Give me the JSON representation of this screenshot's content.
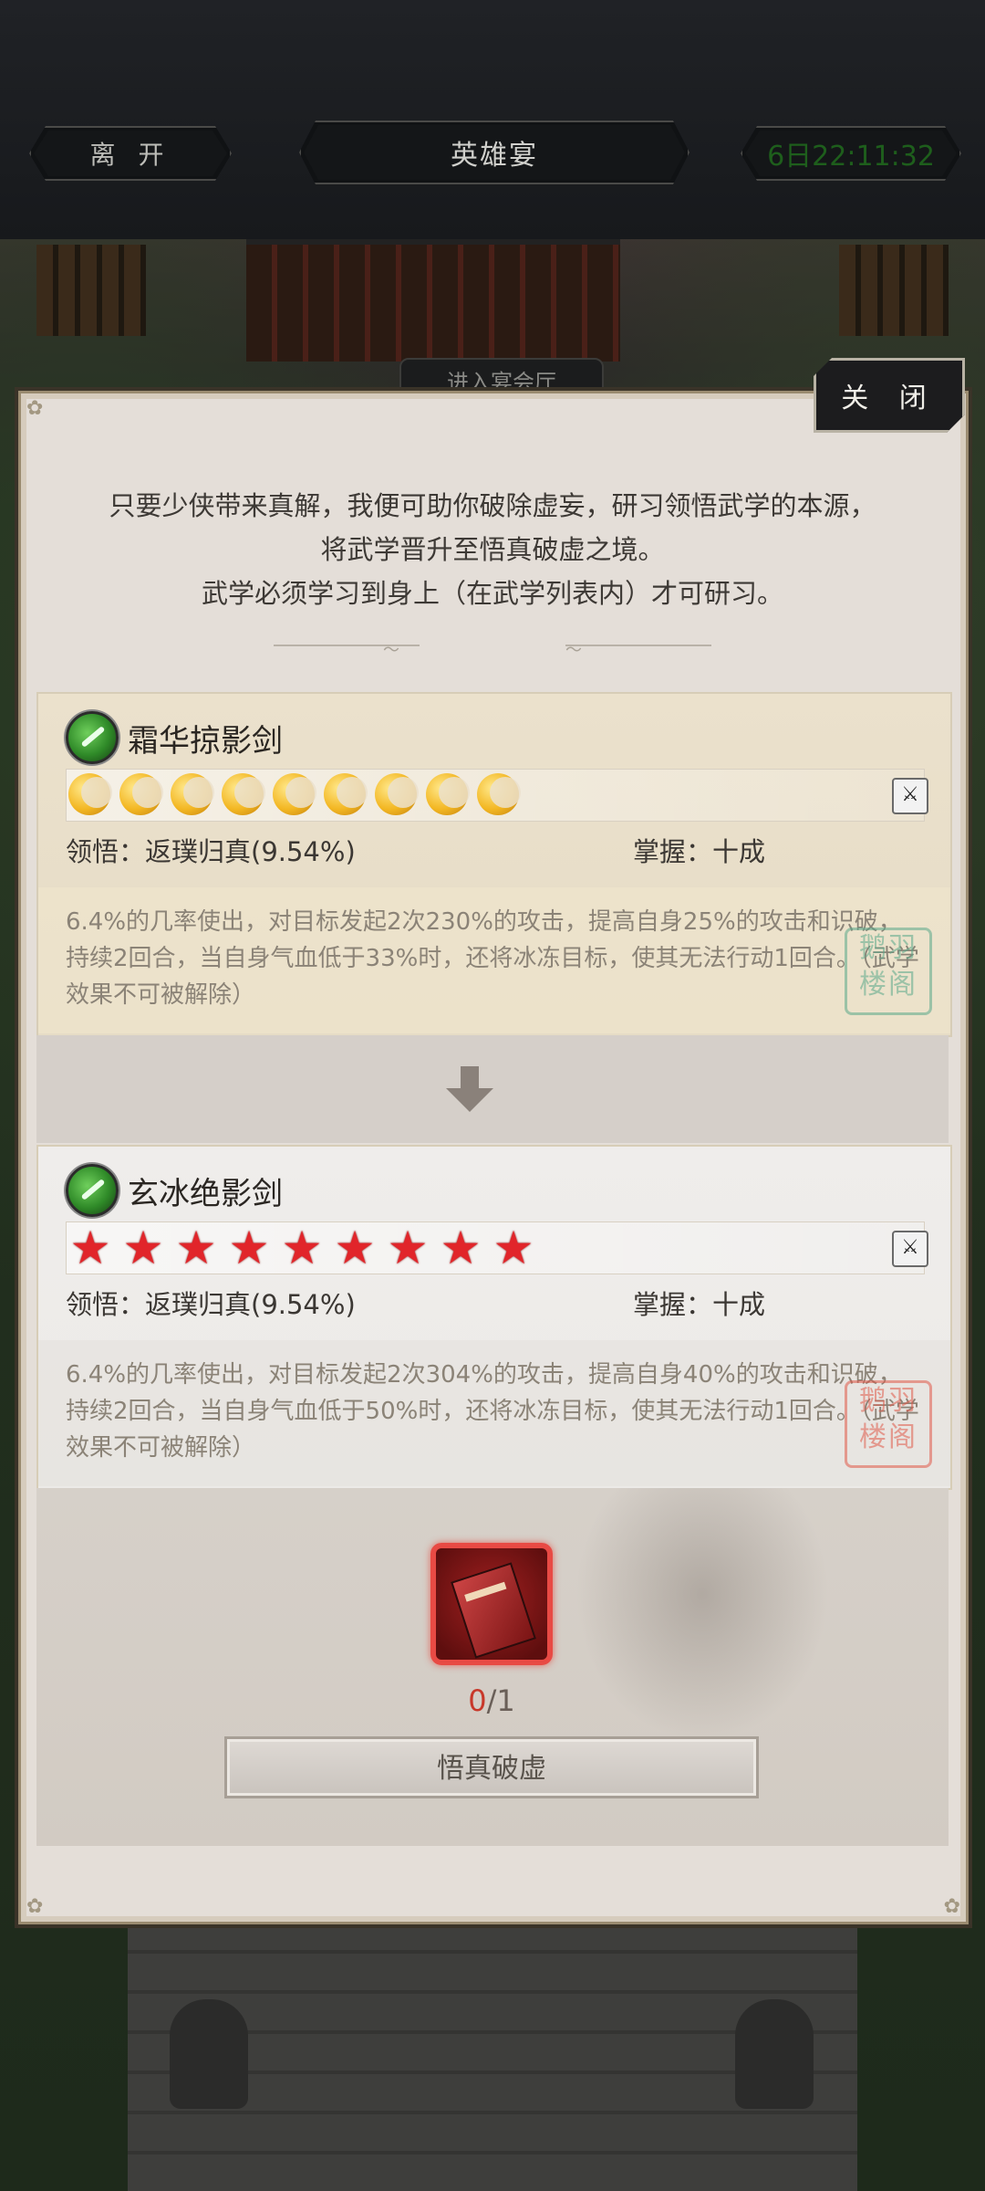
{
  "header": {
    "leave_label": "离 开",
    "title": "英雄宴",
    "timer": "6日22:11:32"
  },
  "scene": {
    "hall_sign": "进入宴会厅"
  },
  "dialog": {
    "close_label": "关 闭",
    "intro": [
      "只要少侠带来真解，我便可助你破除虚妄，研习领悟武学的本源，",
      "将武学晋升至悟真破虚之境。",
      "武学必须学习到身上（在武学列表内）才可研习。"
    ],
    "current_skill": {
      "name": "霜华掠影剑",
      "rank_count": 9,
      "rank_icon": "moon-icon",
      "comprehension": "领悟：返璞归真(9.54%)",
      "mastery": "掌握：十成",
      "description": "6.4%的几率使出，对目标发起2次230%的攻击，提高自身25%的攻击和识破，持续2回合，当自身气血低于33%时，还将冰冻目标，使其无法行动1回合。（武学效果不可被解除）",
      "seal": "鹅羽楼阁"
    },
    "upgraded_skill": {
      "name": "玄冰绝影剑",
      "rank_count": 9,
      "rank_icon": "star-icon",
      "comprehension": "领悟：返璞归真(9.54%)",
      "mastery": "掌握：十成",
      "description": "6.4%的几率使出，对目标发起2次304%的攻击，提高自身40%的攻击和识破，持续2回合，当自身气血低于50%时，还将冰冻目标，使其无法行动1回合。（武学效果不可被解除）",
      "seal": "鹅羽楼阁"
    },
    "material": {
      "icon": "book-icon",
      "have": "0",
      "need": "/1"
    },
    "action_label": "悟真破虚"
  },
  "colors": {
    "timer": "#1e5e1c",
    "star": "#e1252a",
    "moon": "#f3b723",
    "count_have": "#c8382a"
  }
}
